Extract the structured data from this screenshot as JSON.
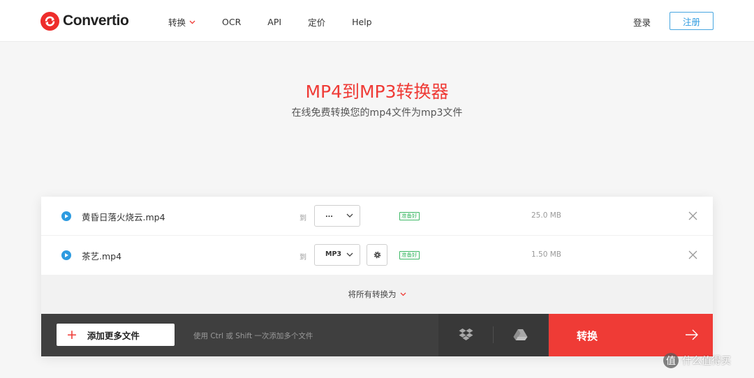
{
  "header": {
    "brand": "Convertio",
    "nav": [
      {
        "label": "转换"
      },
      {
        "label": "OCR"
      },
      {
        "label": "API"
      },
      {
        "label": "定价"
      },
      {
        "label": "Help"
      }
    ],
    "login": "登录",
    "register": "注册"
  },
  "hero": {
    "title": "MP4到MP3转换器",
    "subtitle": "在线免费转换您的mp4文件为mp3文件"
  },
  "files": [
    {
      "name": "黄昏日落火烧云.mp4",
      "to_label": "到",
      "format": "...",
      "status": "准备好",
      "size": "25.0 MB",
      "has_settings": false
    },
    {
      "name": "茶艺.mp4",
      "to_label": "到",
      "format": "MP3",
      "status": "准备好",
      "size": "1.50 MB",
      "has_settings": true
    }
  ],
  "convert_all": "将所有转换为",
  "bottom_bar": {
    "add_files": "添加更多文件",
    "hint": "使用 Ctrl 或 Shift 一次添加多个文件",
    "convert": "转换"
  },
  "watermark": {
    "badge": "值",
    "text": "什么值得买"
  },
  "colors": {
    "brand_red": "#ef3b36",
    "accent_blue": "#2d9be0",
    "ready_green": "#3cb865",
    "bar_dark": "#3f3f3f"
  }
}
